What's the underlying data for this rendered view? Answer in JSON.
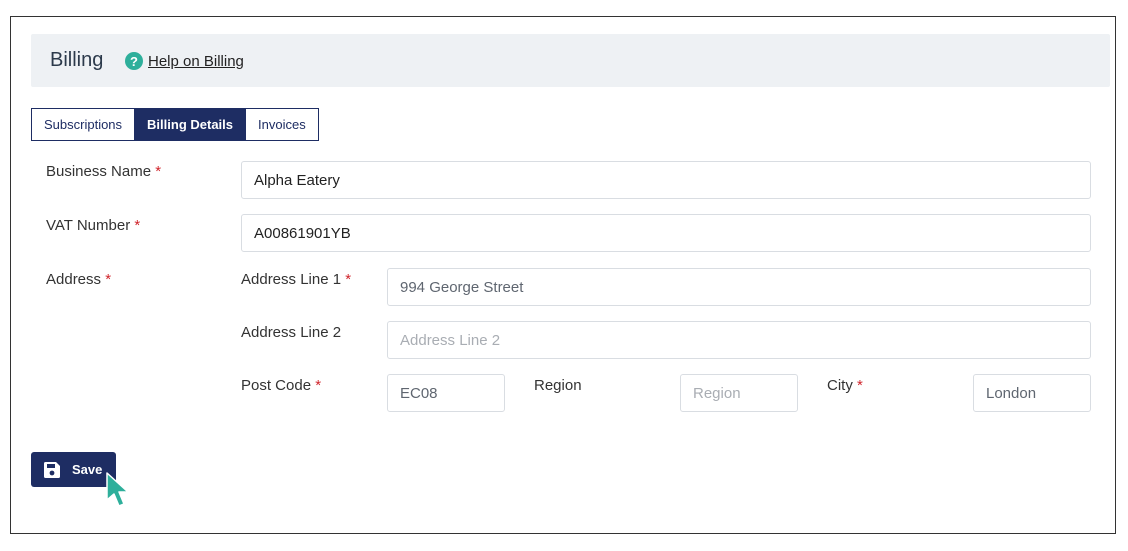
{
  "header": {
    "title": "Billing",
    "help_link": "Help on Billing",
    "help_icon": "question-icon"
  },
  "tabs": [
    {
      "label": "Subscriptions",
      "active": false
    },
    {
      "label": "Billing Details",
      "active": true
    },
    {
      "label": "Invoices",
      "active": false
    }
  ],
  "form": {
    "business_name": {
      "label": "Business Name",
      "required_mark": "*",
      "value": "Alpha Eatery"
    },
    "vat_number": {
      "label": "VAT Number",
      "required_mark": "*",
      "value": "A00861901YB"
    },
    "address": {
      "label": "Address",
      "required_mark": "*"
    },
    "address_line_1": {
      "label": "Address Line 1",
      "required_mark": "*",
      "value": "994 George Street"
    },
    "address_line_2": {
      "label": "Address Line 2",
      "value": "",
      "placeholder": "Address Line 2"
    },
    "post_code": {
      "label": "Post Code",
      "required_mark": "*",
      "value": "EC08"
    },
    "region": {
      "label": "Region",
      "value": "",
      "placeholder": "Region"
    },
    "city": {
      "label": "City",
      "required_mark": "*",
      "value": "London"
    }
  },
  "actions": {
    "save_label": "Save",
    "save_icon": "floppy-disk-icon"
  },
  "colors": {
    "primary": "#1e2d63",
    "accent": "#2eaf9b",
    "required": "#d0242b",
    "header_bg": "#eef1f4"
  }
}
